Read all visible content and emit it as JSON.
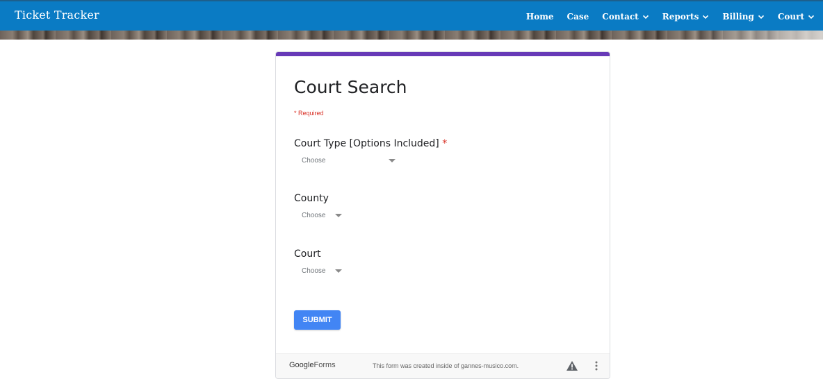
{
  "header": {
    "brand": "Ticket Tracker",
    "nav": [
      {
        "label": "Home",
        "dropdown": false
      },
      {
        "label": "Case",
        "dropdown": false
      },
      {
        "label": "Contact",
        "dropdown": true
      },
      {
        "label": "Reports",
        "dropdown": true
      },
      {
        "label": "Billing",
        "dropdown": true
      },
      {
        "label": "Court",
        "dropdown": true
      }
    ]
  },
  "form": {
    "title": "Court Search",
    "required_note": "* Required",
    "questions": [
      {
        "label": "Court Type [Options Included]",
        "required": true,
        "required_mark": "*",
        "selected": "Choose"
      },
      {
        "label": "County",
        "required": false,
        "selected": "Choose"
      },
      {
        "label": "Court",
        "required": false,
        "selected": "Choose"
      }
    ],
    "submit_label": "SUBMIT",
    "accent_color": "#673ab7",
    "submit_color": "#4285f4"
  },
  "footer": {
    "logo_google": "Google",
    "logo_forms": "Forms",
    "note": "This form was created inside of gannes-musico.com.",
    "warning_icon": "warning-triangle-icon",
    "more_icon": "more-vert-icon"
  },
  "colors": {
    "header_bg": "#0a7bc4"
  }
}
